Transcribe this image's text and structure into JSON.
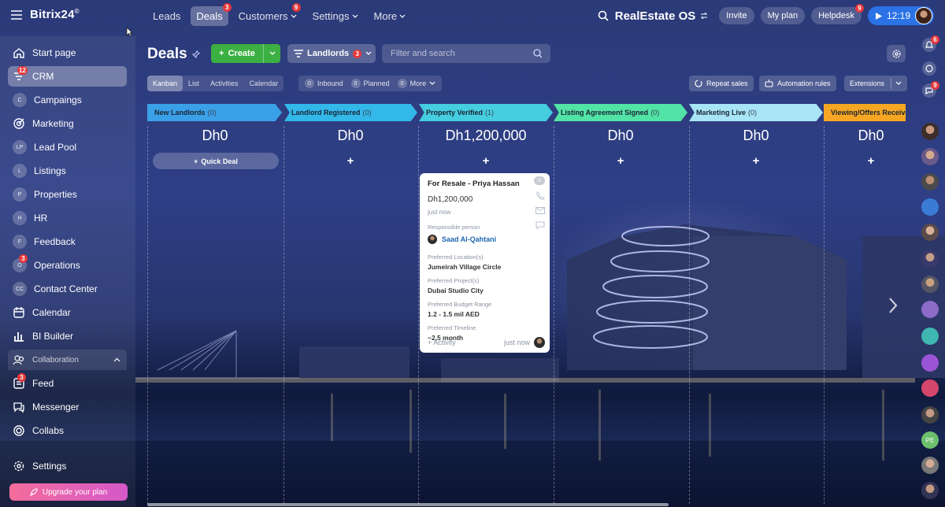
{
  "brand": {
    "name": "Bitrix24",
    "mark": "©"
  },
  "topnav": [
    {
      "label": "Leads",
      "active": false
    },
    {
      "label": "Deals",
      "active": true,
      "badge": "3"
    },
    {
      "label": "Customers",
      "badge": "9",
      "dropdown": true
    },
    {
      "label": "Settings",
      "dropdown": true
    },
    {
      "label": "More",
      "dropdown": true
    }
  ],
  "top_right": {
    "workspace": "RealEstate OS",
    "invite": "Invite",
    "my_plan": "My plan",
    "helpdesk": "Helpdesk",
    "helpdesk_badge": "9",
    "clock": "12:19"
  },
  "sidebar": {
    "items": [
      {
        "label": "Start page",
        "icon": "home-icon"
      },
      {
        "label": "CRM",
        "icon": "crm-filter-icon",
        "badge": "12",
        "active": true
      },
      {
        "label": "Campaings",
        "icon": "letter-circle",
        "letter": "C"
      },
      {
        "label": "Marketing",
        "icon": "marketing-icon"
      },
      {
        "label": "Lead Pool",
        "icon": "letter-circle",
        "letter": "LP"
      },
      {
        "label": "Listings",
        "icon": "letter-circle",
        "letter": "L"
      },
      {
        "label": "Properties",
        "icon": "letter-circle",
        "letter": "P"
      },
      {
        "label": "HR",
        "icon": "letter-circle",
        "letter": "H"
      },
      {
        "label": "Feedback",
        "icon": "letter-circle",
        "letter": "F"
      },
      {
        "label": "Operations",
        "icon": "letter-circle",
        "letter": "O",
        "badge": "3"
      },
      {
        "label": "Contact Center",
        "icon": "letter-circle",
        "letter": "CC"
      },
      {
        "label": "Calendar",
        "icon": "calendar-icon"
      },
      {
        "label": "BI Builder",
        "icon": "chart-icon"
      }
    ],
    "group_label": "Collaboration",
    "collab_items": [
      {
        "label": "Feed",
        "icon": "feed-icon",
        "badge": "3"
      },
      {
        "label": "Messenger",
        "icon": "messenger-icon"
      },
      {
        "label": "Collabs",
        "icon": "collabs-icon"
      }
    ],
    "settings_label": "Settings",
    "upgrade_label": "Upgrade your plan"
  },
  "header": {
    "title": "Deals",
    "create_label": "Create",
    "filter_label": "Landlords",
    "filter_badge": "3",
    "search_placeholder": "Filter and search"
  },
  "views": [
    "Kanban",
    "List",
    "Activities",
    "Calendar"
  ],
  "counters": [
    {
      "count": "0",
      "label": "Inbound"
    },
    {
      "count": "0",
      "label": "Planned"
    },
    {
      "count": "0",
      "label": "More"
    }
  ],
  "actions": {
    "repeat_sales": "Repeat sales",
    "automation": "Automation rules",
    "extensions": "Extensions"
  },
  "stages": [
    {
      "name": "New Landlords",
      "count": "(0)",
      "amount": "Dh0",
      "color": "#3aa0e8"
    },
    {
      "name": "Landlord Registered",
      "count": "(0)",
      "amount": "Dh0",
      "color": "#33b8ea"
    },
    {
      "name": "Property Verified",
      "count": "(1)",
      "amount": "Dh1,200,000",
      "color": "#45cde0"
    },
    {
      "name": "Listing Agreement Signed",
      "count": "(0)",
      "amount": "Dh0",
      "color": "#52e3a6"
    },
    {
      "name": "Marketing Live",
      "count": "(0)",
      "amount": "Dh0",
      "color": "#a8e6f7"
    },
    {
      "name": "Viewing/Offers Receive",
      "count": "",
      "amount": "Dh0",
      "color": "#f5a623"
    }
  ],
  "quick_deal": "Quick Deal",
  "card": {
    "title": "For Resale - Priya Hassan",
    "amount": "Dh1,200,000",
    "time": "just now",
    "responsible_label": "Responsible person",
    "responsible": "Saad Al-Qahtani",
    "fields": [
      {
        "label": "Preferred Location(s)",
        "value": "Jumeirah Village Circle"
      },
      {
        "label": "Preferred Project(s)",
        "value": "Dubai Studio City"
      },
      {
        "label": "Preferred Budget Range",
        "value": "1.2 - 1.5 mil AED"
      },
      {
        "label": "Preferred Timeline",
        "value": "~2,5 month"
      }
    ],
    "activity": "+ Activity",
    "footer_time": "just now",
    "corner_count": "0"
  },
  "rail": {
    "notif_badge": "6",
    "chat_badge": "9",
    "letters": "PE"
  },
  "colors": {
    "create": "#3cb043",
    "badge": "#e5383b",
    "clock": "#2a72e6",
    "link": "#2067b0"
  }
}
